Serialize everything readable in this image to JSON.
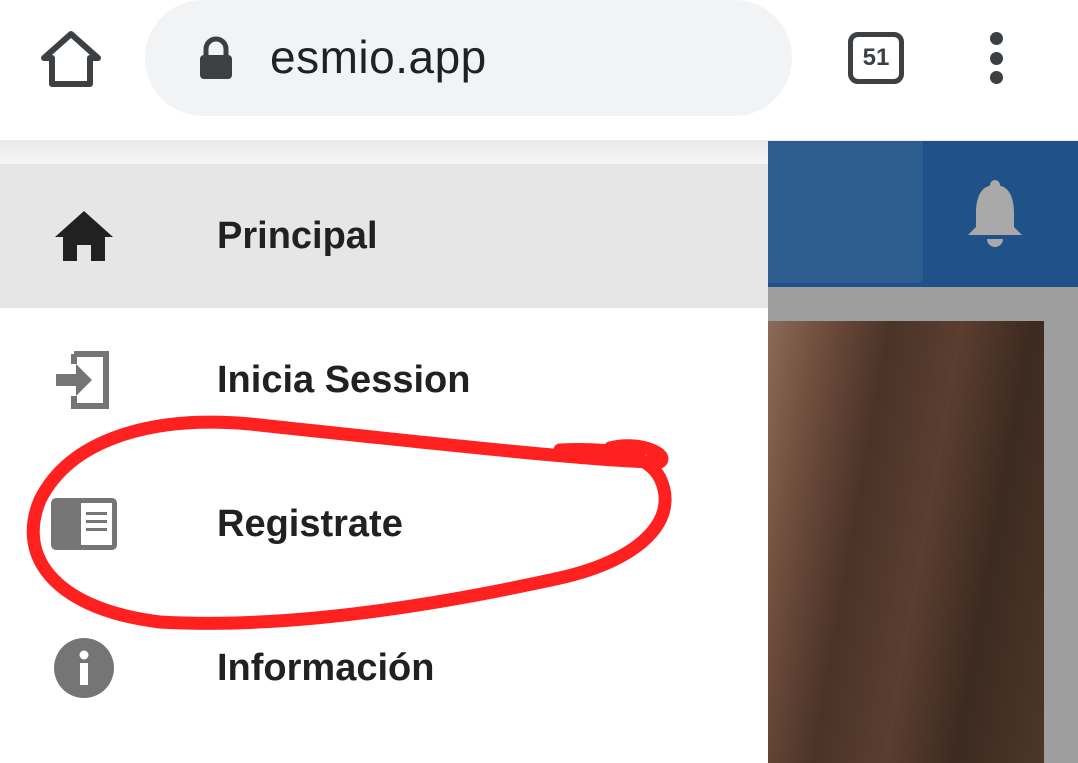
{
  "browser": {
    "url": "esmio.app",
    "tab_count": "51"
  },
  "drawer": {
    "items": [
      {
        "label": "Principal",
        "icon": "home-icon",
        "active": true
      },
      {
        "label": "Inicia Session",
        "icon": "login-icon",
        "active": false
      },
      {
        "label": "Registrate",
        "icon": "register-card-icon",
        "active": false
      },
      {
        "label": "Información",
        "icon": "info-icon",
        "active": false
      }
    ]
  },
  "colors": {
    "header_blue": "#1f5288",
    "annotation_red": "#ff2020",
    "active_item_bg": "#e6e6e6"
  }
}
